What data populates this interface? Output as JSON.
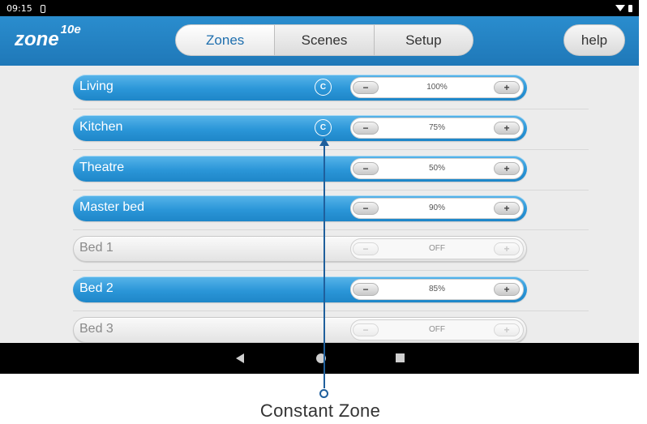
{
  "status_bar": {
    "time": "09:15",
    "icons": [
      "notification-icon",
      "wifi-icon",
      "battery-icon"
    ]
  },
  "app": {
    "logo_text": "zone",
    "logo_superscript": "10e"
  },
  "tabs": [
    {
      "label": "Zones",
      "active": true
    },
    {
      "label": "Scenes",
      "active": false
    },
    {
      "label": "Setup",
      "active": false
    }
  ],
  "help_label": "help",
  "step": {
    "minus": "−",
    "plus": "+"
  },
  "zones": [
    {
      "name": "Living",
      "level": "100%",
      "on": true,
      "constant": true,
      "constant_label": "C"
    },
    {
      "name": "Kitchen",
      "level": "75%",
      "on": true,
      "constant": true,
      "constant_label": "C"
    },
    {
      "name": "Theatre",
      "level": "50%",
      "on": true,
      "constant": false
    },
    {
      "name": "Master bed",
      "level": "90%",
      "on": true,
      "constant": false
    },
    {
      "name": "Bed 1",
      "level": "OFF",
      "on": false,
      "constant": false
    },
    {
      "name": "Bed 2",
      "level": "85%",
      "on": true,
      "constant": false
    },
    {
      "name": "Bed 3",
      "level": "OFF",
      "on": false,
      "constant": false
    }
  ],
  "nav": {
    "icons": [
      "back-icon",
      "home-icon",
      "recent-apps-icon"
    ]
  },
  "callout": {
    "label": "Constant Zone"
  },
  "colors": {
    "header": "#1f78b8",
    "zone_on": "#2b96d8",
    "callout": "#1f5f9c"
  }
}
